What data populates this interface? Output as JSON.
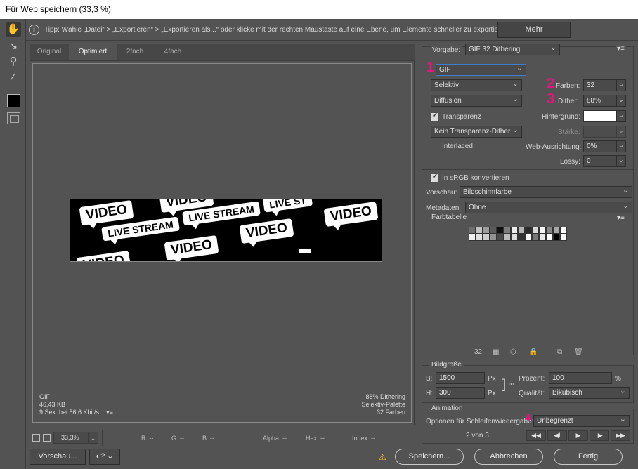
{
  "window": {
    "title": "Für Web speichern (33,3 %)"
  },
  "tip": {
    "text": "Tipp: Wähle „Datei“ > „Exportieren“ > „Exportieren als...“ oder klicke mit der rechten Maustaste auf eine Ebene, um Elemente schneller zu exportieren",
    "more_label": "Mehr"
  },
  "tools": [
    {
      "name": "hand-tool",
      "glyph": "✋"
    },
    {
      "name": "slice-select-tool",
      "glyph": "↘"
    },
    {
      "name": "zoom-tool",
      "glyph": "⚲"
    },
    {
      "name": "eyedropper-tool",
      "glyph": "⁄"
    }
  ],
  "tabs": [
    {
      "label": "Original",
      "active": false
    },
    {
      "label": "Optimiert",
      "active": true
    },
    {
      "label": "2fach",
      "active": false
    },
    {
      "label": "4fach",
      "active": false
    }
  ],
  "preview": {
    "badges": [
      {
        "text": "VIDEO",
        "kind": "v"
      },
      {
        "text": "LIVE STREAM",
        "kind": "ls"
      },
      {
        "text": "LIVE STREAM",
        "kind": "ls"
      },
      {
        "text": "VIDEO",
        "kind": "v"
      },
      {
        "text": "VIDEO",
        "kind": "v"
      },
      {
        "text": "VIDEO",
        "kind": "v"
      },
      {
        "text": "LIVE ST",
        "kind": "ls"
      },
      {
        "text": "VIDEO",
        "kind": "v"
      },
      {
        "text": "VIDEO",
        "kind": "v"
      }
    ],
    "info_left": [
      "GIF",
      "46,43 KB",
      "9 Sek. bei 56,6 Kbit/s"
    ],
    "info_right": [
      "88% Dithering",
      "Selektiv-Palette",
      "32 Farben"
    ],
    "menu_glyph": "▾≡"
  },
  "statusbar": {
    "zoom": "33,3%",
    "fields": [
      {
        "label": "R: --"
      },
      {
        "label": "G: --"
      },
      {
        "label": "B: --"
      },
      {
        "label": "Alpha: --"
      },
      {
        "label": "Hex: --"
      },
      {
        "label": "Index: --"
      }
    ]
  },
  "bottom": {
    "preview_label": "Vorschau...",
    "save_label": "Speichern...",
    "cancel_label": "Abbrechen",
    "done_label": "Fertig"
  },
  "settings": {
    "preset_label": "Vorgabe:",
    "preset_value": "GIF 32 Dithering",
    "format": "GIF",
    "reduction": "Selektiv",
    "dither_algo": "Diffusion",
    "transparency_label": "Transparenz",
    "transparency_checked": true,
    "trans_dither": "Kein Transparenz-Dither",
    "interlaced_label": "Interlaced",
    "interlaced_checked": false,
    "colors_label": "Farben:",
    "colors_value": "32",
    "dither_label": "Dither:",
    "dither_value": "88%",
    "matte_label": "Hintergrund:",
    "amount_label": "Stärke:",
    "websnap_label": "Web-Ausrichtung:",
    "websnap_value": "0%",
    "lossy_label": "Lossy:",
    "lossy_value": "0",
    "srgb_label": "In sRGB konvertieren",
    "srgb_checked": true,
    "preview_label": "Vorschau:",
    "preview_value": "Bildschirmfarbe",
    "metadata_label": "Metadaten:",
    "metadata_value": "Ohne",
    "markers": [
      "1",
      "2",
      "3",
      "4"
    ]
  },
  "color_table": {
    "title": "Farbtabelle",
    "count": "32",
    "colors": [
      "#6e6e6e",
      "#c2c2c2",
      "#9c9c9c",
      "#5a5a5a",
      "#101010",
      "#7c7c7c",
      "#ececec",
      "#b4b4b4",
      "#2a2a2a",
      "#d8d8d8",
      "#f6f6f6",
      "#878787",
      "#a8a8a8",
      "#ffffff",
      "#f0f0f0",
      "#e0e0e0",
      "#cfcfcf",
      "#929292",
      "#4a4a4a",
      "#bcbcbc",
      "#dedede",
      "#333333",
      "#ffffff",
      "#777777",
      "#e8e8e8",
      "#ffffff",
      "#000000",
      "#fafafa"
    ]
  },
  "image_size": {
    "title": "Bildgröße",
    "w_label": "B:",
    "w_value": "1500",
    "h_label": "H:",
    "h_value": "300",
    "unit": "Px",
    "percent_label": "Prozent:",
    "percent_value": "100",
    "percent_unit": "%",
    "quality_label": "Qualität:",
    "quality_value": "Bikubisch"
  },
  "animation": {
    "title": "Animation",
    "loop_label": "Optionen für Schleifenwiedergabe:",
    "loop_value": "Unbegrenzt",
    "frame_label": "2 von 3",
    "buttons": [
      "◀◀",
      "◀I",
      "▶",
      "I▶",
      "▶▶"
    ]
  },
  "colors": {
    "accent_marker": "#e0187e",
    "focus": "#3c7fd1",
    "panel": "#535353"
  }
}
